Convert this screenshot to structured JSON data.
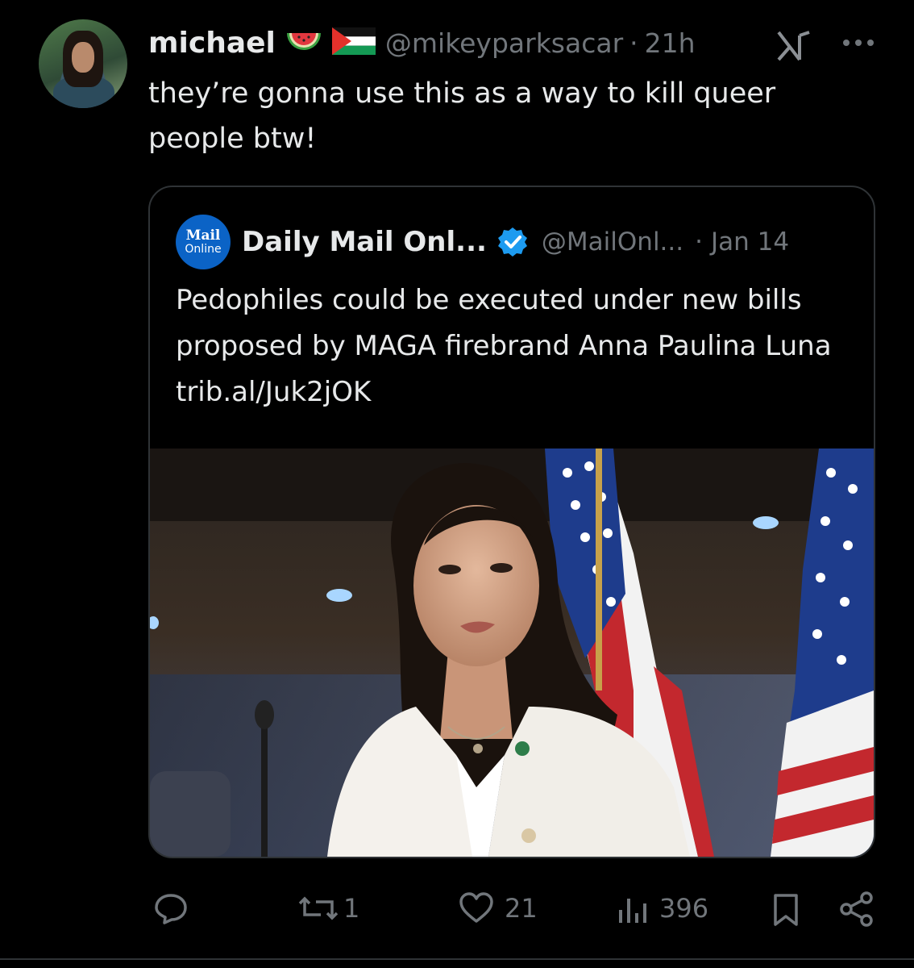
{
  "author": {
    "display_name": "michael",
    "emoji": [
      "watermelon",
      "palestine-flag"
    ],
    "handle": "@mikeyparksacar",
    "time": "21h"
  },
  "tweet": {
    "text": "they’re gonna use this as a way to kill queer people btw!"
  },
  "quote": {
    "logo_top": "Mail",
    "logo_bottom": "Online",
    "display_name": "Daily Mail Onl...",
    "verified": true,
    "handle": "@MailOnl...",
    "date": "Jan 14",
    "text": "Pedophiles could be executed under new bills proposed by MAGA firebrand Anna Paulina Luna trib.al/Juk2jOK"
  },
  "actions": {
    "replies": "",
    "reposts": "1",
    "likes": "21",
    "views": "396"
  },
  "icons": [
    "grok-icon",
    "more-icon",
    "verified-icon",
    "reply-icon",
    "repost-icon",
    "like-icon",
    "views-icon",
    "bookmark-icon",
    "share-icon"
  ],
  "colors": {
    "background": "#000000",
    "text": "#e7e9ea",
    "muted": "#71767b",
    "verified": "#1d9bf0",
    "border": "#2f3336"
  }
}
